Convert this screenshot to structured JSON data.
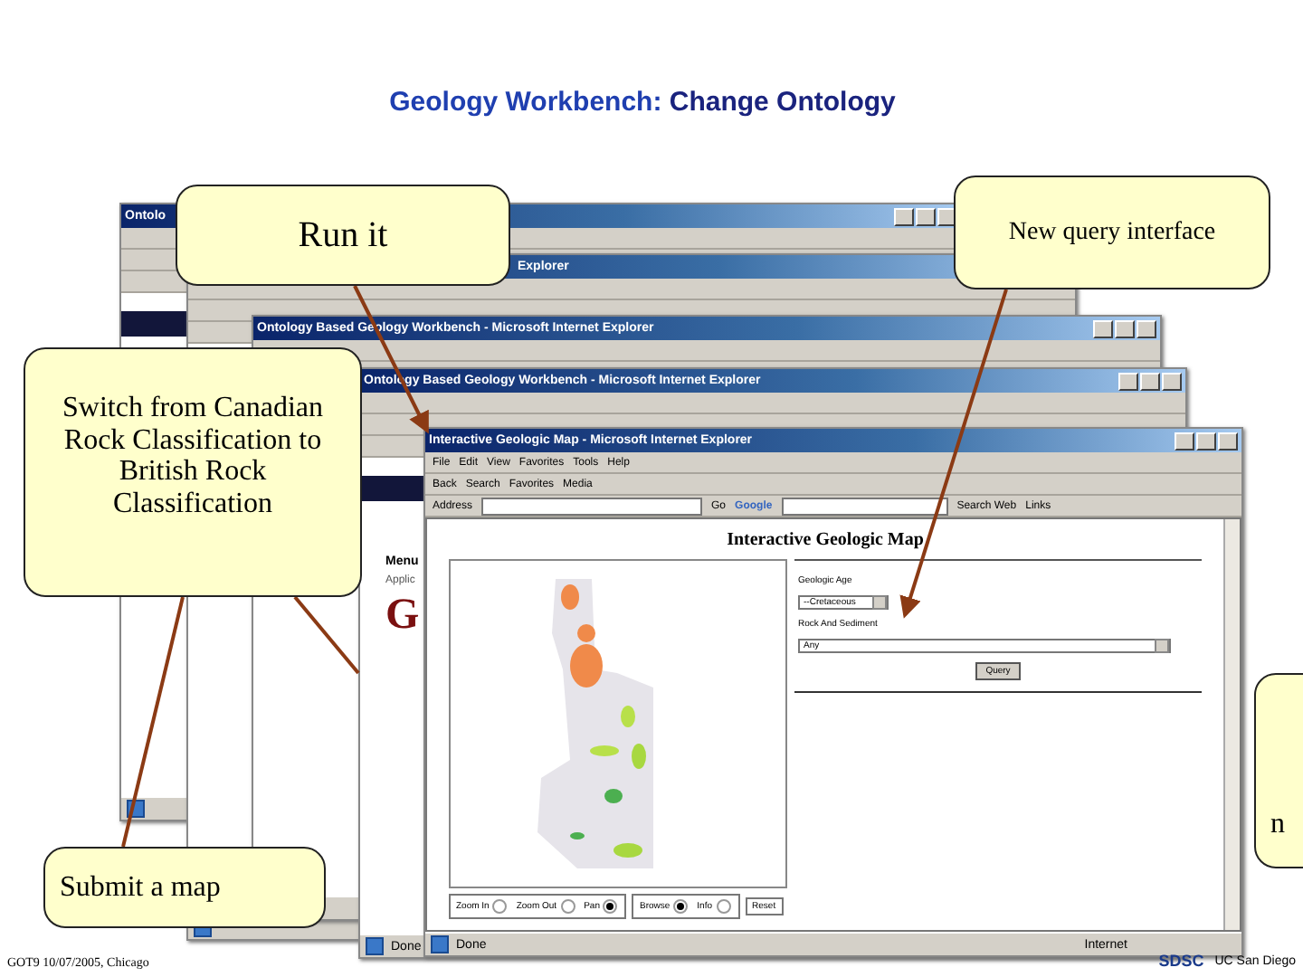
{
  "title": "**Geology Workbench:** Change Ontology",
  "back_windows": [
    {
      "title": "Ontolo"
    },
    {
      "title": "Explorer"
    },
    {
      "title": "Ontology Based Geology Workbench - Microsoft Internet Explorer"
    },
    {
      "title": "Ontology Based Geology Workbench - Microsoft Internet Explorer",
      "status": "Done",
      "menu_heading": "Menu",
      "menu_item": "Applic",
      "logo_letter": "G"
    }
  ],
  "front_window": {
    "title": "Interactive Geologic Map - Microsoft Internet Explorer",
    "menu": [
      "File",
      "Edit",
      "View",
      "Favorites",
      "Tools",
      "Help"
    ],
    "toolbar": [
      "Back",
      "Search",
      "Favorites",
      "Media"
    ],
    "address_label": "Address",
    "go": "Go",
    "search_brand": "Google",
    "search_web": "Search Web",
    "links": "Links",
    "heading": "Interactive Geologic Map",
    "age_label": "Geologic Age",
    "age_value": "--Cretaceous",
    "rock_label": "Rock And Sediment",
    "rock_value": "Any",
    "query_button": "Query",
    "map_tools": [
      {
        "label": "Zoom In",
        "selected": false
      },
      {
        "label": "Zoom Out",
        "selected": false
      },
      {
        "label": "Pan",
        "selected": true
      }
    ],
    "mode_tools": [
      {
        "label": "Browse",
        "selected": true
      },
      {
        "label": "Info",
        "selected": false
      }
    ],
    "reset_button": "Reset",
    "status": "Done",
    "zone": "Internet"
  },
  "callouts": [
    {
      "text": "Run it"
    },
    {
      "text": "New query interface"
    },
    {
      "text": "Switch from Canadian Rock Classification to British Rock Classification"
    },
    {
      "text": "Submit a map"
    },
    {
      "text": "n"
    }
  ],
  "footer": "GOT9 10/07/2005, Chicago",
  "logos": [
    "SDSC",
    "UC San Diego"
  ]
}
